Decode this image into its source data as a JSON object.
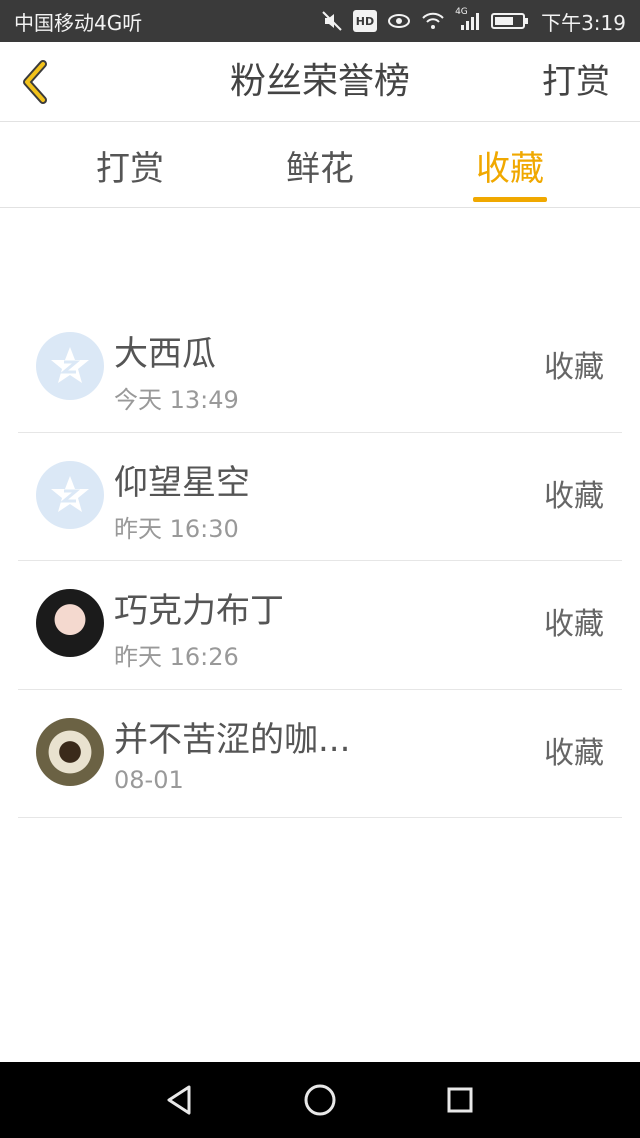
{
  "status_bar": {
    "carrier": "中国移动4G听",
    "time": "下午3:19",
    "hd_label": "HD",
    "network_label": "4G"
  },
  "header": {
    "title": "粉丝荣誉榜",
    "right_action": "打赏"
  },
  "tabs": [
    {
      "label": "打赏",
      "active": false
    },
    {
      "label": "鲜花",
      "active": false
    },
    {
      "label": "收藏",
      "active": true
    }
  ],
  "list": [
    {
      "name": "大西瓜",
      "time": "今天 13:49",
      "action": "收藏",
      "avatar": "default-avatar-icon"
    },
    {
      "name": "仰望星空",
      "time": "昨天 16:30",
      "action": "收藏",
      "avatar": "default-avatar-icon"
    },
    {
      "name": "巧克力布丁",
      "time": "昨天 16:26",
      "action": "收藏",
      "avatar": "user-photo"
    },
    {
      "name": "并不苦涩的咖...",
      "time": "08-01",
      "action": "收藏",
      "avatar": "coffee-photo"
    }
  ],
  "colors": {
    "accent": "#f0a800",
    "status_bar": "#3a3a3a",
    "nav_bar": "#000000"
  }
}
